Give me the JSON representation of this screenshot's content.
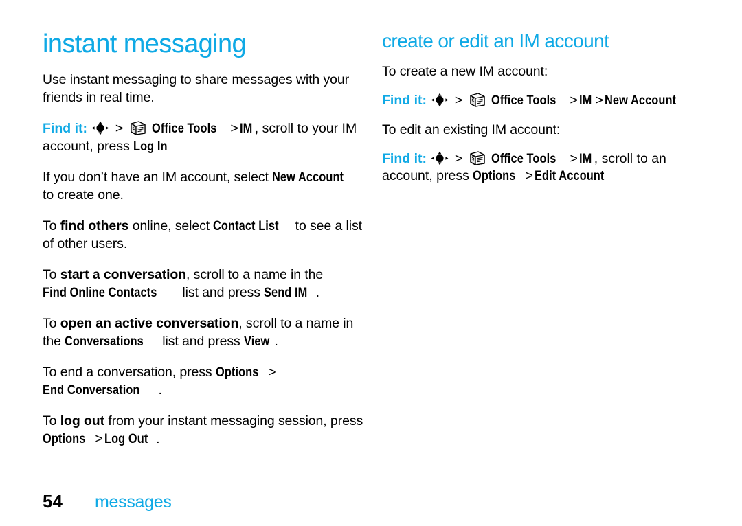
{
  "colors": {
    "accent": "#0fa9e5",
    "text": "#000000",
    "background": "#ffffff"
  },
  "left_column": {
    "title": "instant messaging",
    "intro": "Use instant messaging to share messages with your friends in real time.",
    "find_it_1": {
      "label": "Find it:",
      "nav_icon": "navigation-key-icon",
      "sep": ">",
      "app_icon": "office-tools-icon",
      "app": "Office Tools",
      "menu": "IM",
      "tail_1": ", scroll to your IM account, press ",
      "action": "Log In"
    },
    "para_new_account": {
      "pre": "If you don’t have an IM account, select ",
      "ui": "New Account",
      "post": " to create one."
    },
    "para_find_others": {
      "pre": "To ",
      "emph": "find others",
      "mid": " online, select ",
      "ui": "Contact List",
      "post": " to see a list of other users."
    },
    "para_start_conversation": {
      "pre": "To ",
      "emph": "start a conversation",
      "mid": ", scroll to a name in the ",
      "ui1": "Find Online Contacts",
      "mid2": " list and press ",
      "ui2": "Send IM",
      "post": "."
    },
    "para_open_conversation": {
      "pre": "To ",
      "emph": "open an active conversation",
      "mid": ", scroll to a name in the ",
      "ui1": "Conversations",
      "mid2": " list and press ",
      "ui2": "View",
      "post": "."
    },
    "para_end_conversation": {
      "pre": "To end a conversation, press ",
      "ui1": "Options",
      "sep": ">",
      "ui2": "End Conversation",
      "post": "."
    },
    "para_log_out": {
      "pre": "To ",
      "emph": "log out",
      "mid": " from your instant messaging session, press ",
      "ui1": "Options",
      "sep": ">",
      "ui2": "Log Out",
      "post": "."
    }
  },
  "right_column": {
    "title": "create or edit an IM account",
    "lead_create": "To create a new IM account:",
    "find_it_create": {
      "label": "Find it:",
      "nav_icon": "navigation-key-icon",
      "sep": ">",
      "app_icon": "office-tools-icon",
      "app": "Office Tools",
      "menu": "IM",
      "target": "New Account"
    },
    "lead_edit": "To edit an existing IM account:",
    "find_it_edit": {
      "label": "Find it:",
      "nav_icon": "navigation-key-icon",
      "sep": ">",
      "app_icon": "office-tools-icon",
      "app": "Office Tools",
      "menu": "IM",
      "tail": ", scroll to an account, press ",
      "ui1": "Options",
      "sep2": ">",
      "ui2": "Edit Account"
    }
  },
  "footer": {
    "page_number": "54",
    "chapter": "messages"
  }
}
